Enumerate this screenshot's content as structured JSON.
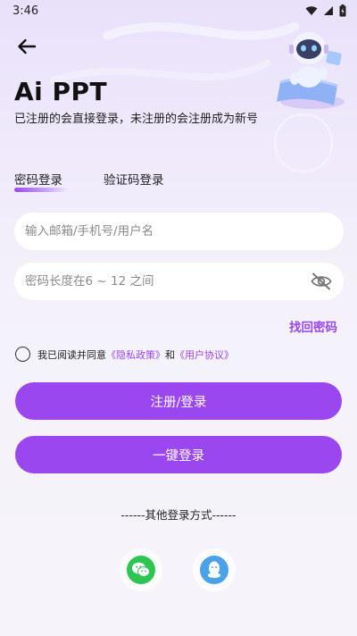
{
  "status_bar": {
    "time": "3:46",
    "icons": [
      "wifi-icon",
      "signal-icon",
      "battery-icon"
    ]
  },
  "header": {
    "back_icon": "back-arrow-icon",
    "app_title": "Ai PPT",
    "subtitle": "已注册的会直接登录，未注册的会注册成为新号"
  },
  "tabs": [
    {
      "label": "密码登录",
      "active": true
    },
    {
      "label": "验证码登录",
      "active": false
    }
  ],
  "form": {
    "account_placeholder": "输入邮箱/手机号/用户名",
    "account_value": "",
    "password_placeholder": "密码长度在6 ~ 12 之间",
    "password_value": "",
    "password_toggle_icon": "eye-off-icon",
    "forgot_password": "找回密码"
  },
  "agreement": {
    "checked": false,
    "prefix": "我已阅读并同意",
    "privacy_link": "《隐私政策》",
    "and": "和",
    "terms_link": "《用户协议》"
  },
  "buttons": {
    "login_register": "注册/登录",
    "one_click_login": "一键登录"
  },
  "other_methods": {
    "label": "------其他登录方式------",
    "providers": [
      "wechat-icon",
      "qq-icon"
    ]
  },
  "colors": {
    "accent": "#9a47f0",
    "link": "#9a45ee",
    "wechat": "#2fc552",
    "qq": "#4aa3e8"
  }
}
